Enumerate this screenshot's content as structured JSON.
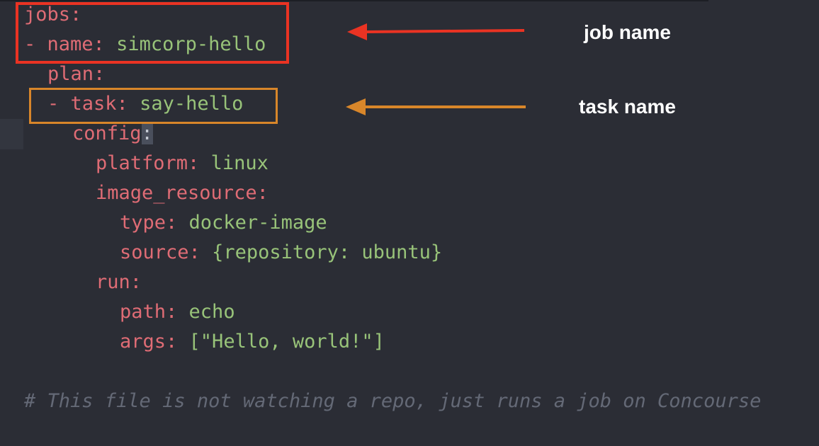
{
  "code": {
    "line1": {
      "key": "jobs",
      "colon": ":"
    },
    "line2": {
      "dash": "- ",
      "key": "name",
      "colon": ": ",
      "value": "simcorp-hello"
    },
    "line3": {
      "key": "plan",
      "colon": ":"
    },
    "line4": {
      "dash": "- ",
      "key": "task",
      "colon": ": ",
      "value": "say-hello"
    },
    "line5": {
      "key": "config",
      "colon": ":"
    },
    "line6": {
      "key": "platform",
      "colon": ": ",
      "value": "linux"
    },
    "line7": {
      "key": "image_resource",
      "colon": ":"
    },
    "line8": {
      "key": "type",
      "colon": ": ",
      "value": "docker-image"
    },
    "line9": {
      "key": "source",
      "colon": ": ",
      "value": "{repository: ubuntu}"
    },
    "line10": {
      "key": "run",
      "colon": ":"
    },
    "line11": {
      "key": "path",
      "colon": ": ",
      "value": "echo"
    },
    "line12": {
      "key": "args",
      "colon": ": ",
      "value": "[\"Hello, world!\"]"
    },
    "comment": "# This file is not watching a repo, just runs a job on Concourse"
  },
  "annotations": {
    "job_name": {
      "label": "job name",
      "color": "#ea3323"
    },
    "task_name": {
      "label": "task name",
      "color": "#d8862a"
    }
  },
  "colors": {
    "background": "#2b2d35",
    "key": "#df6c75",
    "string": "#98c379",
    "comment": "#646976"
  }
}
